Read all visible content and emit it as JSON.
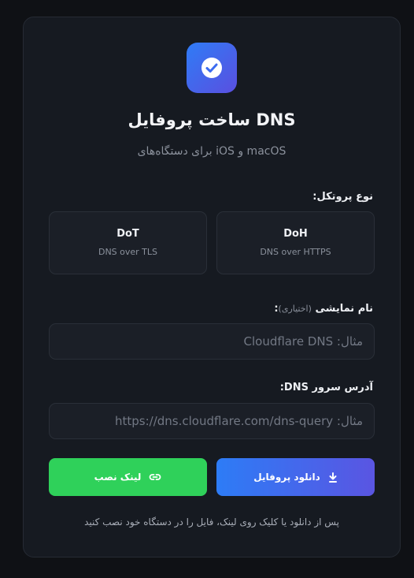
{
  "header": {
    "title": "ساخت پروفایل DNS",
    "subtitle": "برای دستگاه‌های iOS و macOS",
    "icon": "check-circle-icon"
  },
  "protocol": {
    "label": "نوع پروتکل:",
    "options": [
      {
        "name": "DoH",
        "description": "DNS over HTTPS"
      },
      {
        "name": "DoT",
        "description": "DNS over TLS"
      }
    ]
  },
  "display_name": {
    "label": "نام نمایشی",
    "optional": "(اختیاری)",
    "colon": ":",
    "placeholder": "مثال: Cloudflare DNS",
    "value": ""
  },
  "server_address": {
    "label": "آدرس سرور DNS:",
    "placeholder": "مثال: https://dns.cloudflare.com/dns-query",
    "value": ""
  },
  "actions": {
    "download_label": "دانلود پروفایل",
    "download_icon": "download-icon",
    "install_link_label": "لینک نصب",
    "install_link_icon": "link-icon"
  },
  "footer_note": "پس از دانلود یا کلیک روی لینک، فایل را در دستگاه خود نصب کنید",
  "colors": {
    "background": "#0f1115",
    "card": "#161a21",
    "accent_blue": "#2d7cf6",
    "accent_purple": "#5a55e2",
    "accent_green": "#2fd15a"
  }
}
